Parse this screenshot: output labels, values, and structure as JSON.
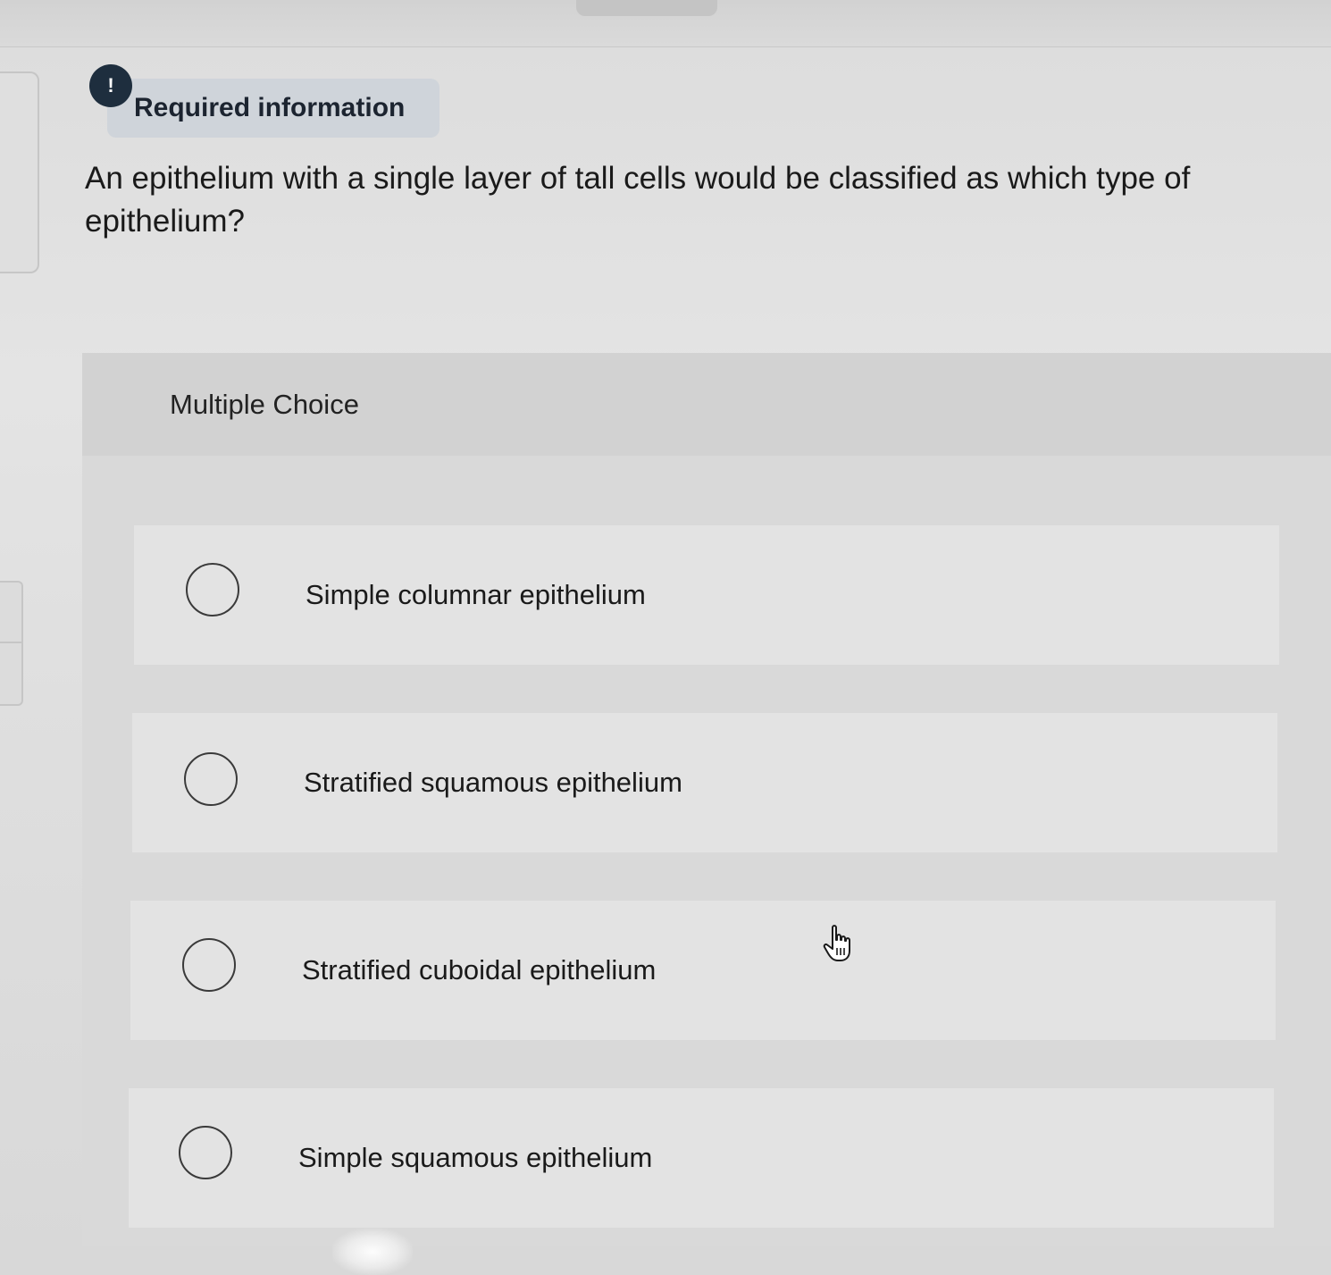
{
  "notice": {
    "icon": "exclamation-icon",
    "icon_glyph": "!",
    "label": "Required information"
  },
  "question": {
    "text": "An epithelium with a single layer of tall cells would be classified as which type of epithelium?"
  },
  "multiple_choice": {
    "title": "Multiple Choice",
    "options": [
      {
        "label": "Simple columnar epithelium",
        "selected": false
      },
      {
        "label": "Stratified squamous epithelium",
        "selected": false
      },
      {
        "label": "Stratified cuboidal epithelium",
        "selected": false
      },
      {
        "label": "Simple squamous epithelium",
        "selected": false
      }
    ]
  },
  "cursor": {
    "icon": "hand-pointer-icon"
  },
  "colors": {
    "notice_icon_bg": "#1e2e3e",
    "notice_badge_bg": "#cfd4da",
    "text": "#1a1a1a"
  }
}
